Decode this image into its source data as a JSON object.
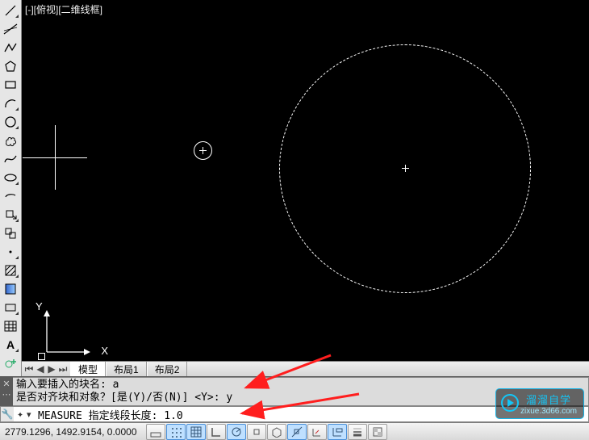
{
  "view_label": "[-][俯视][二维线框]",
  "ucs": {
    "x_label": "X",
    "y_label": "Y"
  },
  "palette_tools": [
    {
      "name": "line",
      "fly": true
    },
    {
      "name": "construction-line",
      "fly": false
    },
    {
      "name": "polyline",
      "fly": false
    },
    {
      "name": "polygon",
      "fly": false
    },
    {
      "name": "rectangle",
      "fly": false
    },
    {
      "name": "arc",
      "fly": true
    },
    {
      "name": "circle",
      "fly": true
    },
    {
      "name": "revision-cloud",
      "fly": false
    },
    {
      "name": "spline",
      "fly": false
    },
    {
      "name": "ellipse",
      "fly": true
    },
    {
      "name": "ellipse-arc",
      "fly": false
    },
    {
      "name": "insert-block",
      "fly": true
    },
    {
      "name": "make-block",
      "fly": false
    },
    {
      "name": "point",
      "fly": true
    },
    {
      "name": "hatch",
      "fly": true
    },
    {
      "name": "gradient",
      "fly": false
    },
    {
      "name": "region",
      "fly": true
    },
    {
      "name": "table",
      "fly": false
    },
    {
      "name": "text",
      "fly": true
    },
    {
      "name": "addselect",
      "fly": false
    }
  ],
  "tabs": {
    "model": "模型",
    "layout1": "布局1",
    "layout2": "布局2"
  },
  "cmd_history": {
    "line1_prefix": "输入要插入的块名: ",
    "line1_value": "a",
    "line2": "是否对齐块和对象？[是(Y)/否(N)] <Y>: y"
  },
  "cmd_current": {
    "command": "MEASURE",
    "prompt": "指定线段长度: ",
    "value": "1.0"
  },
  "status": {
    "coords": "2779.1296, 1492.9154, 0.0000"
  },
  "watermark": {
    "line1": "溜溜自学",
    "line2": "zixue.3d66.com"
  }
}
